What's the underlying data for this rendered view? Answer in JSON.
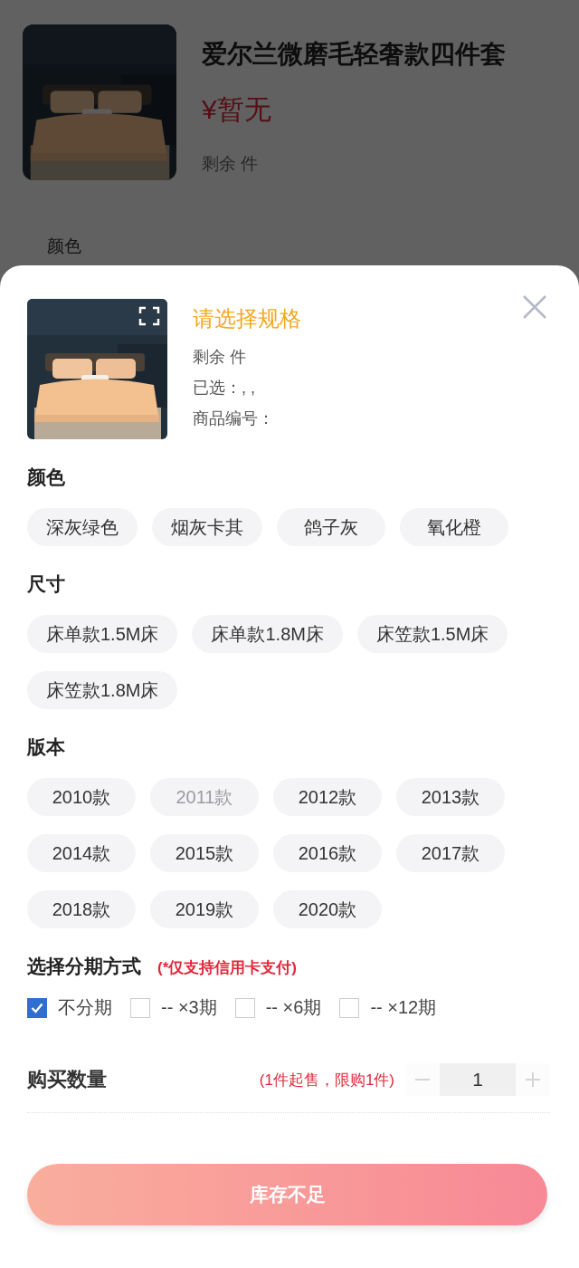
{
  "background_page": {
    "title": "爱尔兰微磨毛轻奢款四件套",
    "price": "¥暂无",
    "stock": "剩余 件",
    "section_label": "颜色"
  },
  "sheet": {
    "title": "请选择规格",
    "stock": "剩余 件",
    "selected_specs": "已选：, ,",
    "product_code": "商品编号：",
    "spec_groups": [
      {
        "title": "颜色",
        "options": [
          {
            "label": "深灰绿色",
            "selected": false,
            "disabled": false
          },
          {
            "label": "烟灰卡其",
            "selected": false,
            "disabled": false
          },
          {
            "label": "鸽子灰",
            "selected": false,
            "disabled": false
          },
          {
            "label": "氧化橙",
            "selected": false,
            "disabled": false
          }
        ]
      },
      {
        "title": "尺寸",
        "options": [
          {
            "label": "床单款1.5M床",
            "selected": false,
            "disabled": false
          },
          {
            "label": "床单款1.8M床",
            "selected": false,
            "disabled": false
          },
          {
            "label": "床笠款1.5M床",
            "selected": false,
            "disabled": false
          },
          {
            "label": "床笠款1.8M床",
            "selected": false,
            "disabled": false
          }
        ]
      },
      {
        "title": "版本",
        "options": [
          {
            "label": "2010款",
            "selected": false,
            "disabled": false
          },
          {
            "label": "2011款",
            "selected": false,
            "disabled": true
          },
          {
            "label": "2012款",
            "selected": false,
            "disabled": false
          },
          {
            "label": "2013款",
            "selected": false,
            "disabled": false
          },
          {
            "label": "2014款",
            "selected": false,
            "disabled": false
          },
          {
            "label": "2015款",
            "selected": false,
            "disabled": false
          },
          {
            "label": "2016款",
            "selected": false,
            "disabled": false
          },
          {
            "label": "2017款",
            "selected": false,
            "disabled": false
          },
          {
            "label": "2018款",
            "selected": false,
            "disabled": false
          },
          {
            "label": "2019款",
            "selected": false,
            "disabled": false
          },
          {
            "label": "2020款",
            "selected": false,
            "disabled": false
          }
        ]
      }
    ],
    "installment": {
      "title": "选择分期方式",
      "note": "(*仅支持信用卡支付)",
      "options": [
        {
          "label": "不分期",
          "checked": true
        },
        {
          "label": "-- ×3期",
          "checked": false
        },
        {
          "label": "-- ×6期",
          "checked": false
        },
        {
          "label": "-- ×12期",
          "checked": false
        }
      ]
    },
    "quantity": {
      "label": "购买数量",
      "note": "(1件起售，限购1件)",
      "value": "1",
      "minus_disabled": true,
      "plus_disabled": true
    },
    "submit": {
      "label": "库存不足",
      "disabled": true
    }
  }
}
